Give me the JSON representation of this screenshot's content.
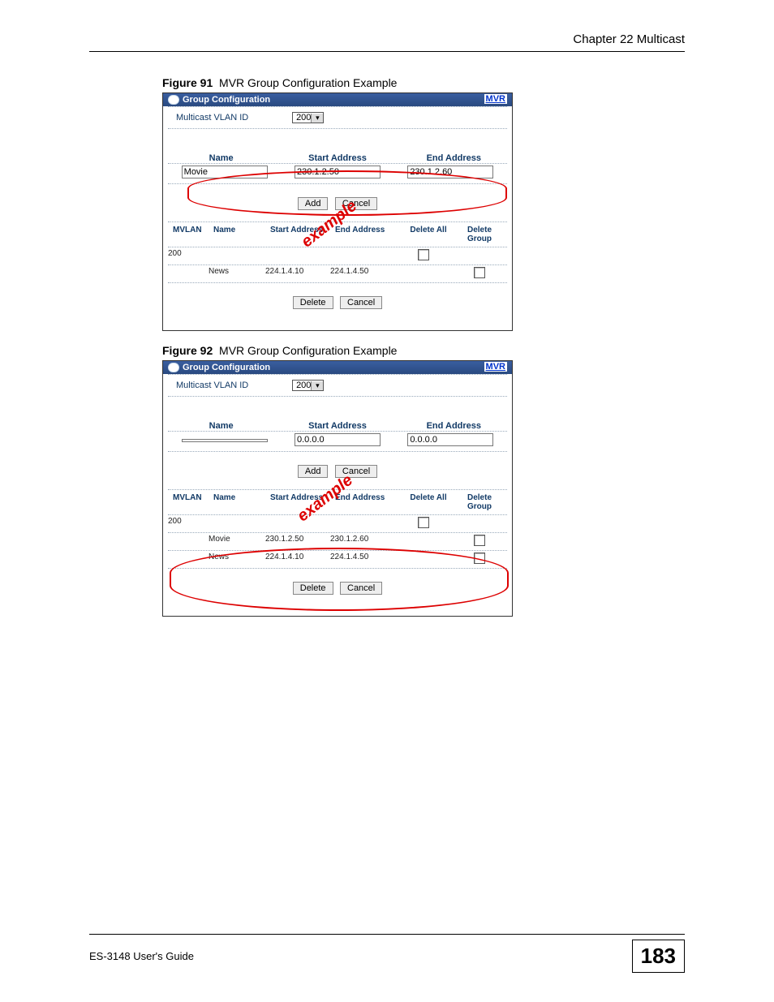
{
  "header": {
    "chapter": "Chapter 22 Multicast"
  },
  "figures": {
    "f91": {
      "label": "Figure 91",
      "title": "MVR Group Configuration Example"
    },
    "f92": {
      "label": "Figure 92",
      "title": "MVR Group Configuration Example"
    }
  },
  "panel": {
    "title": "Group Configuration",
    "mvr_link": "MVR",
    "vlan_label": "Multicast VLAN ID",
    "vlan_value": "200",
    "col_name": "Name",
    "col_start": "Start Address",
    "col_end": "End Address",
    "btn_add": "Add",
    "btn_cancel": "Cancel",
    "btn_delete": "Delete",
    "th_mvlan": "MVLAN",
    "th_name": "Name",
    "th_start": "Start Address",
    "th_end": "End Address",
    "th_delall": "Delete All",
    "th_delgrp": "Delete Group"
  },
  "fig91": {
    "name_input": "Movie",
    "start_input": "230.1.2.50",
    "end_input": "230.1.2.60",
    "rows": [
      {
        "mvlan": "200",
        "name": "",
        "start": "",
        "end": ""
      },
      {
        "mvlan": "",
        "name": "News",
        "start": "224.1.4.10",
        "end": "224.1.4.50"
      }
    ]
  },
  "fig92": {
    "name_input": "",
    "start_input": "0.0.0.0",
    "end_input": "0.0.0.0",
    "rows": [
      {
        "mvlan": "200",
        "name": "",
        "start": "",
        "end": ""
      },
      {
        "mvlan": "",
        "name": "Movie",
        "start": "230.1.2.50",
        "end": "230.1.2.60"
      },
      {
        "mvlan": "",
        "name": "News",
        "start": "224.1.4.10",
        "end": "224.1.4.50"
      }
    ]
  },
  "example_watermark": "example",
  "footer": {
    "guide": "ES-3148 User's Guide",
    "page": "183"
  }
}
